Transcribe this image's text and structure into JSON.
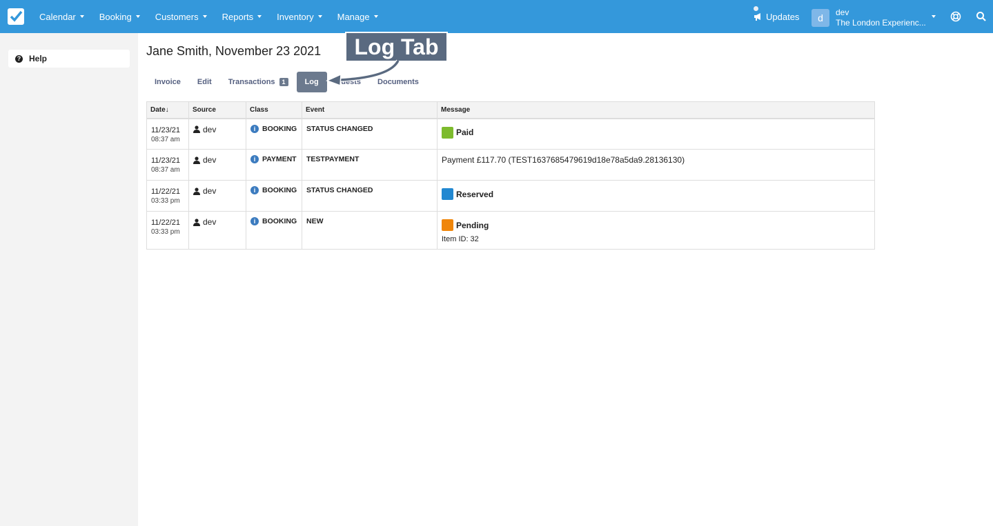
{
  "nav": {
    "items": [
      "Calendar",
      "Booking",
      "Customers",
      "Reports",
      "Inventory",
      "Manage"
    ],
    "updates_label": "Updates",
    "user_initial": "d",
    "user_name": "dev",
    "user_company": "The London Experienc..."
  },
  "sidebar": {
    "help_label": "Help"
  },
  "page": {
    "title": "Jane Smith, November 23 2021"
  },
  "tabs": {
    "invoice": "Invoice",
    "edit": "Edit",
    "transactions": "Transactions",
    "transactions_count": "1",
    "log": "Log",
    "guests": "Guests",
    "documents": "Documents"
  },
  "callout": {
    "text": "Log Tab"
  },
  "table": {
    "headers": {
      "date": "Date↓",
      "source": "Source",
      "class": "Class",
      "event": "Event",
      "message": "Message"
    },
    "rows": [
      {
        "date": "11/23/21",
        "time": "08:37 am",
        "source": "dev",
        "class": "BOOKING",
        "event": "STATUS CHANGED",
        "status": "Paid",
        "status_color": "#7dbb2d",
        "message": "",
        "sub": ""
      },
      {
        "date": "11/23/21",
        "time": "08:37 am",
        "source": "dev",
        "class": "PAYMENT",
        "event": "TESTPAYMENT",
        "status": "",
        "status_color": "",
        "message": "Payment £117.70 (TEST1637685479619d18e78a5da9.28136130)",
        "sub": ""
      },
      {
        "date": "11/22/21",
        "time": "03:33 pm",
        "source": "dev",
        "class": "BOOKING",
        "event": "STATUS CHANGED",
        "status": "Reserved",
        "status_color": "#2288d1",
        "message": "",
        "sub": ""
      },
      {
        "date": "11/22/21",
        "time": "03:33 pm",
        "source": "dev",
        "class": "BOOKING",
        "event": "NEW",
        "status": "Pending",
        "status_color": "#f0860a",
        "message": "",
        "sub": "Item ID: 32"
      }
    ]
  },
  "colors": {
    "topbar": "#3498db",
    "tab_active": "#6c7a8e"
  }
}
